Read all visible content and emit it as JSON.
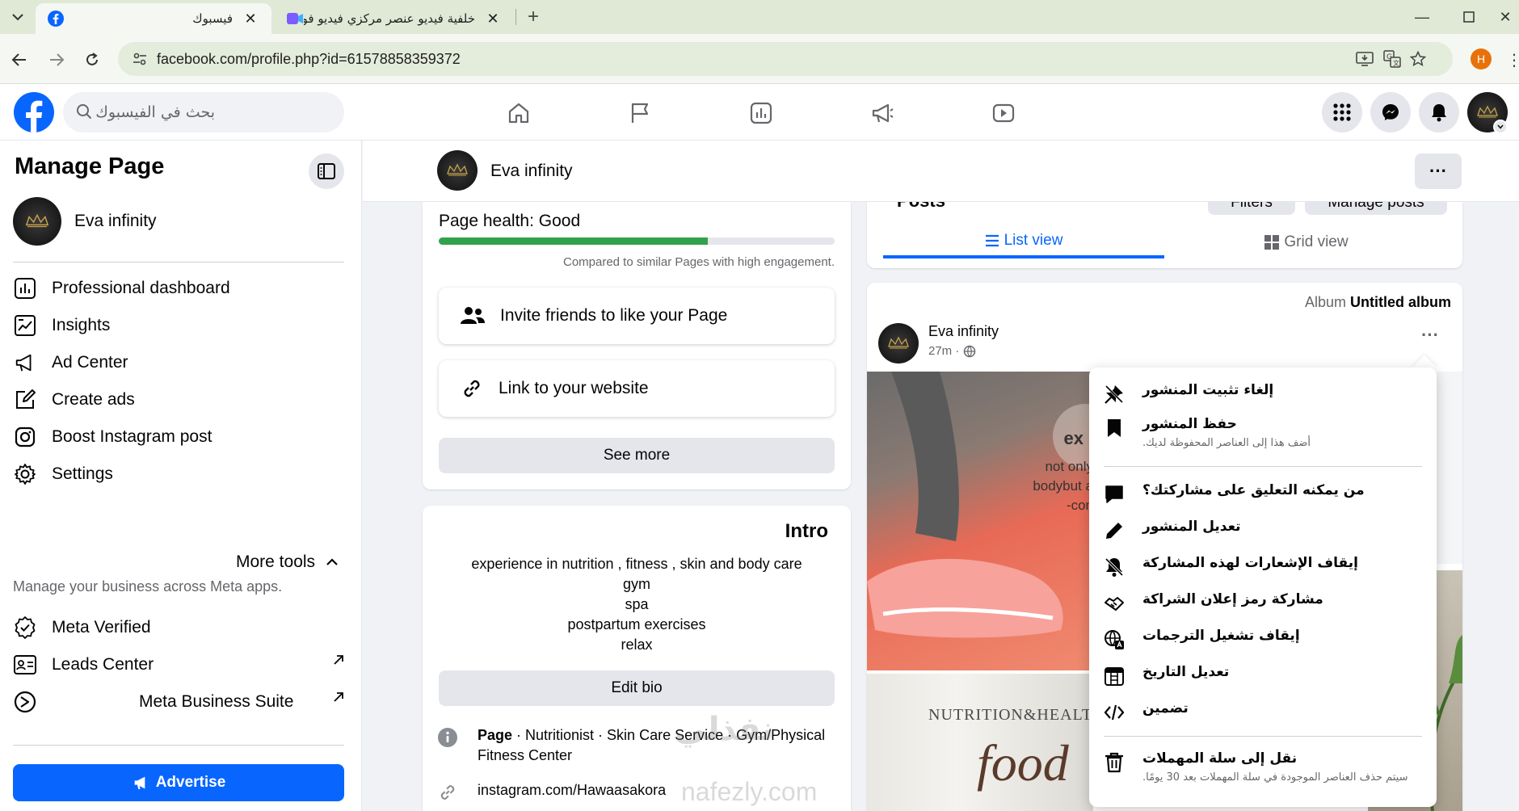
{
  "browser": {
    "tabs": [
      {
        "title": "فيسبوك",
        "active": true
      },
      {
        "title": "خلفية فيديو عنصر مركزي فيديو فو",
        "active": false
      }
    ],
    "url": "facebook.com/profile.php?id=61578858359372",
    "profile_initial": "H"
  },
  "fb": {
    "search_placeholder": "بحث في الفيسبوك"
  },
  "sidebar": {
    "title": "Manage Page",
    "page_name": "Eva infinity",
    "items": [
      {
        "label": "Professional dashboard",
        "icon": "dashboard-icon"
      },
      {
        "label": "Insights",
        "icon": "insights-icon"
      },
      {
        "label": "Ad Center",
        "icon": "megaphone-icon"
      },
      {
        "label": "Create ads",
        "icon": "pencil-square-icon"
      },
      {
        "label": "Boost Instagram post",
        "icon": "instagram-icon"
      },
      {
        "label": "Settings",
        "icon": "gear-icon"
      }
    ],
    "more_tools": "More tools",
    "more_tools_desc": "Manage your business across Meta apps.",
    "tools": [
      {
        "label": "Meta Verified",
        "icon": "verified-badge-icon"
      },
      {
        "label": "Leads Center",
        "icon": "contact-card-icon"
      },
      {
        "label": "Meta Business Suite",
        "icon": "business-suite-icon"
      }
    ],
    "advertise": "Advertise"
  },
  "page_header": {
    "name": "Eva infinity"
  },
  "health": {
    "title": "Page health: Good",
    "level": 0.68,
    "note": "Compared to similar Pages with high engagement."
  },
  "actions": {
    "invite": "Invite friends to like your Page",
    "link": "Link to your website",
    "see_more": "See more"
  },
  "intro": {
    "title": "Intro",
    "bio": [
      "experience in nutrition , fitness , skin and body care",
      "gym",
      "spa",
      "postpartum exercises",
      "relax"
    ],
    "edit_bio": "Edit bio",
    "page_label": "Page",
    "page_categories": " · Nutritionist · Skin Care Service · Gym/Physical Fitness Center",
    "website": "instagram.com/Hawaasakora"
  },
  "posts": {
    "ghost_title": "Posts",
    "ghost_filters": "Filters",
    "ghost_manage": "Manage posts",
    "list_view": "List view",
    "grid_view": "Grid view",
    "album_prefix": "Album",
    "album_name": "Untitled album",
    "author": "Eva infinity",
    "time": "27m ·",
    "photo_texts": [
      "ex",
      "not only",
      "bodybut a",
      "-con",
      "NUTRITION&HEALT",
      "food"
    ]
  },
  "menu": {
    "items": [
      {
        "label": "إلغاء تثبيت المنشور",
        "icon": "unpin-icon"
      },
      {
        "label": "حفظ المنشور",
        "sub": "أضف هذا إلى العناصر المحفوظة لديك.",
        "icon": "bookmark-icon"
      },
      {
        "label": "من يمكنه التعليق على مشاركتك؟",
        "icon": "comment-icon"
      },
      {
        "label": "تعديل المنشور",
        "icon": "edit-pencil-icon"
      },
      {
        "label": "إيقاف الإشعارات لهذه المشاركة",
        "icon": "bell-off-icon"
      },
      {
        "label": "مشاركة رمز إعلان الشراكة",
        "icon": "handshake-icon"
      },
      {
        "label": "إيقاف تشغيل الترجمات",
        "icon": "globe-translate-icon"
      },
      {
        "label": "تعديل التاريخ",
        "icon": "calendar-icon"
      },
      {
        "label": "تضمين",
        "icon": "code-icon"
      },
      {
        "label": "نقل إلى سلة المهملات",
        "sub": "سيتم حذف العناصر الموجودة في سلة المهملات بعد 30 يومًا.",
        "icon": "trash-icon"
      }
    ]
  },
  "watermark": {
    "arabic": "نفذلي",
    "latin": "nafezly.com"
  },
  "colors": {
    "fb_blue": "#0866ff",
    "health_green": "#31a24c",
    "chrome_tab_bg": "#dfe9d6"
  }
}
